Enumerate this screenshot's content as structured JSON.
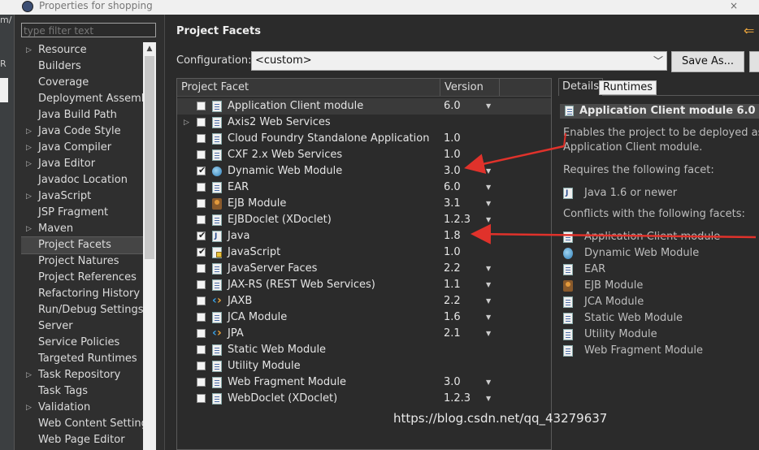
{
  "window": {
    "title": "Properties for shopping",
    "close_icon": "×"
  },
  "left_strip": {
    "fragments": [
      "m/",
      "R"
    ]
  },
  "filter": {
    "placeholder": "type filter text"
  },
  "nav": {
    "items": [
      {
        "label": "Resource",
        "expandable": true
      },
      {
        "label": "Builders",
        "expandable": false
      },
      {
        "label": "Coverage",
        "expandable": false
      },
      {
        "label": "Deployment Assembly",
        "expandable": false
      },
      {
        "label": "Java Build Path",
        "expandable": false
      },
      {
        "label": "Java Code Style",
        "expandable": true
      },
      {
        "label": "Java Compiler",
        "expandable": true
      },
      {
        "label": "Java Editor",
        "expandable": true
      },
      {
        "label": "Javadoc Location",
        "expandable": false
      },
      {
        "label": "JavaScript",
        "expandable": true
      },
      {
        "label": "JSP Fragment",
        "expandable": false
      },
      {
        "label": "Maven",
        "expandable": true
      },
      {
        "label": "Project Facets",
        "expandable": false,
        "selected": true
      },
      {
        "label": "Project Natures",
        "expandable": false
      },
      {
        "label": "Project References",
        "expandable": false
      },
      {
        "label": "Refactoring History",
        "expandable": false
      },
      {
        "label": "Run/Debug Settings",
        "expandable": false
      },
      {
        "label": "Server",
        "expandable": false
      },
      {
        "label": "Service Policies",
        "expandable": false
      },
      {
        "label": "Targeted Runtimes",
        "expandable": false
      },
      {
        "label": "Task Repository",
        "expandable": true
      },
      {
        "label": "Task Tags",
        "expandable": false
      },
      {
        "label": "Validation",
        "expandable": true
      },
      {
        "label": "Web Content Settings",
        "expandable": false
      },
      {
        "label": "Web Page Editor",
        "expandable": false
      }
    ]
  },
  "page": {
    "title": "Project Facets"
  },
  "configuration": {
    "label": "Configuration:",
    "value": "<custom>",
    "save_label": "Save As..."
  },
  "facets": {
    "header_facet": "Project Facet",
    "header_version": "Version",
    "rows": [
      {
        "name": "Application Client module",
        "version": "6.0",
        "checked": false,
        "icon": "page-icon",
        "dropdown": true,
        "selected": true
      },
      {
        "name": "Axis2 Web Services",
        "version": "",
        "checked": false,
        "icon": "page-icon",
        "dropdown": false,
        "expandable": true
      },
      {
        "name": "Cloud Foundry Standalone Application",
        "version": "1.0",
        "checked": false,
        "icon": "page-icon",
        "dropdown": false
      },
      {
        "name": "CXF 2.x Web Services",
        "version": "1.0",
        "checked": false,
        "icon": "page-icon",
        "dropdown": false
      },
      {
        "name": "Dynamic Web Module",
        "version": "3.0",
        "checked": true,
        "icon": "globe-icon",
        "dropdown": true
      },
      {
        "name": "EAR",
        "version": "6.0",
        "checked": false,
        "icon": "page-icon",
        "dropdown": true
      },
      {
        "name": "EJB Module",
        "version": "3.1",
        "checked": false,
        "icon": "bean-icon",
        "dropdown": true
      },
      {
        "name": "EJBDoclet (XDoclet)",
        "version": "1.2.3",
        "checked": false,
        "icon": "page-icon",
        "dropdown": true
      },
      {
        "name": "Java",
        "version": "1.8",
        "checked": true,
        "icon": "java-icon",
        "dropdown": true
      },
      {
        "name": "JavaScript",
        "version": "1.0",
        "checked": true,
        "icon": "js-icon",
        "dropdown": false
      },
      {
        "name": "JavaServer Faces",
        "version": "2.2",
        "checked": false,
        "icon": "page-icon",
        "dropdown": true
      },
      {
        "name": "JAX-RS (REST Web Services)",
        "version": "1.1",
        "checked": false,
        "icon": "page-icon",
        "dropdown": true
      },
      {
        "name": "JAXB",
        "version": "2.2",
        "checked": false,
        "icon": "xml-icon",
        "dropdown": true
      },
      {
        "name": "JCA Module",
        "version": "1.6",
        "checked": false,
        "icon": "page-icon",
        "dropdown": true
      },
      {
        "name": "JPA",
        "version": "2.1",
        "checked": false,
        "icon": "xml-icon",
        "dropdown": true
      },
      {
        "name": "Static Web Module",
        "version": "",
        "checked": false,
        "icon": "page-icon",
        "dropdown": false
      },
      {
        "name": "Utility Module",
        "version": "",
        "checked": false,
        "icon": "page-icon",
        "dropdown": false
      },
      {
        "name": "Web Fragment Module",
        "version": "3.0",
        "checked": false,
        "icon": "page-icon",
        "dropdown": true
      },
      {
        "name": "WebDoclet (XDoclet)",
        "version": "1.2.3",
        "checked": false,
        "icon": "page-icon",
        "dropdown": true
      }
    ]
  },
  "details": {
    "tab_details": "Details",
    "tab_runtimes": "Runtimes",
    "title": "Application Client module 6.0",
    "description_line1": "Enables the project to be deployed as a J",
    "description_line2": "Application Client module.",
    "requires_label": "Requires the following facet:",
    "requires": [
      {
        "label": "Java 1.6 or newer",
        "icon": "java-icon"
      }
    ],
    "conflicts_label": "Conflicts with the following facets:",
    "conflicts": [
      {
        "label": "Application Client module",
        "icon": "page-icon"
      },
      {
        "label": "Dynamic Web Module",
        "icon": "globe-icon"
      },
      {
        "label": "EAR",
        "icon": "page-icon"
      },
      {
        "label": "EJB Module",
        "icon": "bean-icon"
      },
      {
        "label": "JCA Module",
        "icon": "page-icon"
      },
      {
        "label": "Static Web Module",
        "icon": "page-icon"
      },
      {
        "label": "Utility Module",
        "icon": "page-icon"
      },
      {
        "label": "Web Fragment Module",
        "icon": "page-icon"
      }
    ]
  },
  "watermark": "https://blog.csdn.net/qq_43279637",
  "colors": {
    "annotation_arrow": "#e0322b",
    "back_arrow": "#e8a33c"
  }
}
